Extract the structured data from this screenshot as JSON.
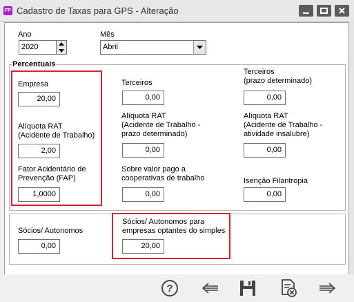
{
  "window": {
    "title": "Cadastro de Taxas para GPS - Alteração",
    "icon": "fp-app-icon"
  },
  "period": {
    "ano_label": "Ano",
    "ano_value": "2020",
    "mes_label": "Mês",
    "mes_value": "Abril"
  },
  "percentuais": {
    "title": "Percentuais",
    "empresa_label": "Empresa",
    "empresa_value": "20,00",
    "terceiros_label": "Terceiros",
    "terceiros_value": "0,00",
    "terceiros_prazo_label": "Terceiros\n(prazo determinado)",
    "terceiros_prazo_value": "0,00",
    "rat_label": "Alíquota RAT\n(Acidente de Trabalho)",
    "rat_value": "2,00",
    "rat_prazo_label": "Alíquota RAT\n(Acidente de Trabalho -\nprazo determinado)",
    "rat_prazo_value": "0,00",
    "rat_insalubre_label": "Alíquota RAT\n(Acidente de Trabalho -\natividade insalubre)",
    "rat_insalubre_value": "0,00",
    "fap_label": "Fator Acidentário de\nPrevenção (FAP)",
    "fap_value": "1,0000",
    "cooperativas_label": "Sobre valor pago a\ncooperativas de trabalho",
    "cooperativas_value": "0,00",
    "isencao_label": "Isenção Filantropia",
    "isencao_value": "0,00"
  },
  "socios": {
    "autonomos_label": "Sócios/ Autonomos",
    "autonomos_value": "0,00",
    "simples_label": "Sócios/ Autonomos para\nempresas optantes do simples",
    "simples_value": "20,00"
  },
  "toolbar": {
    "icons": [
      "help-icon",
      "back-arrow-icon",
      "save-icon",
      "cancel-document-icon",
      "forward-arrow-icon"
    ]
  },
  "colors": {
    "highlight": "#d9222e",
    "app_icon": "#a81fd0"
  }
}
